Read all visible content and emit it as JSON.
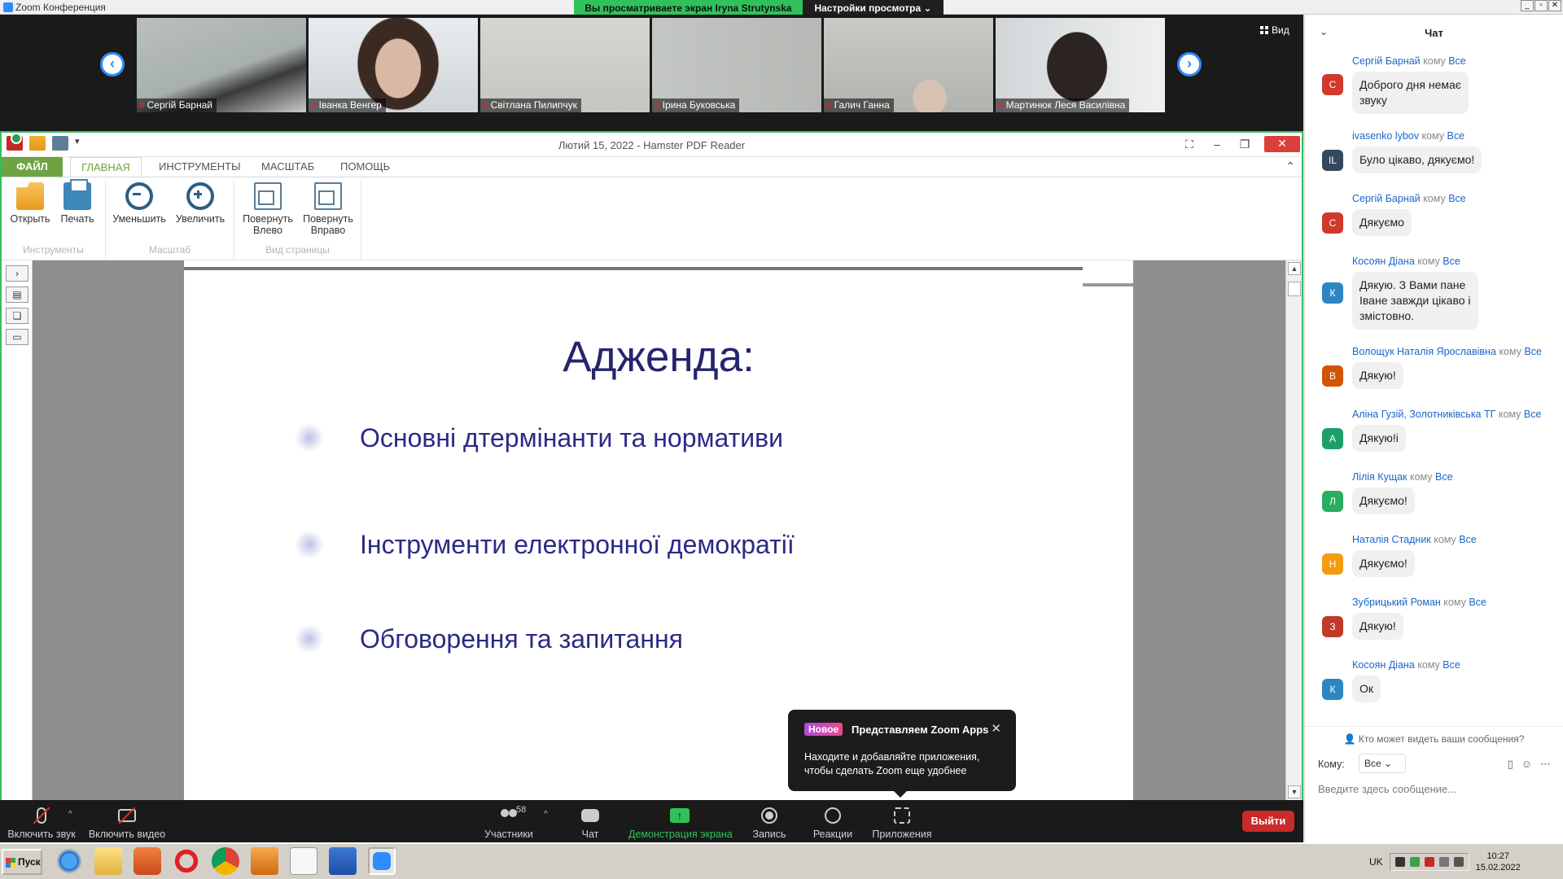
{
  "zoom": {
    "window_title": "Zoom Конференция",
    "share_banner": "Вы просматриваете экран Iryna Strutynska",
    "view_settings": "Настройки просмотра ⌄",
    "view_button": "Вид",
    "participants": [
      {
        "name": "Сергій Барнай"
      },
      {
        "name": "Іванка Венгер"
      },
      {
        "name": "Світлана Пилипчук"
      },
      {
        "name": "Ірина Буковська"
      },
      {
        "name": "Галич Ганна"
      },
      {
        "name": "Мартинюк Леся Василівна"
      }
    ]
  },
  "pdf": {
    "title": "Лютий 15, 2022 - Hamster PDF Reader",
    "tabs": {
      "file": "ФАЙЛ",
      "home": "ГЛАВНАЯ",
      "tools": "ИНСТРУМЕНТЫ",
      "scale": "МАСШТАБ",
      "help": "ПОМОЩЬ"
    },
    "ribbon": {
      "open": "Открыть",
      "print": "Печать",
      "group_tools": "Инструменты",
      "zoom_out": "Уменьшить",
      "zoom_in": "Увеличить",
      "group_scale": "Масштаб",
      "rotate_left_1": "Повернуть",
      "rotate_left_2": "Влево",
      "rotate_right_1": "Повернуть",
      "rotate_right_2": "Вправо",
      "group_view": "Вид страницы"
    },
    "slide": {
      "heading": "Адженда:",
      "items": [
        "Основні дтермінанти та нормативи",
        "Інструменти електронної демократії",
        "Обговорення та запитання"
      ]
    }
  },
  "popup": {
    "badge": "Новое",
    "title": "Представляем Zoom Apps",
    "body": "Находите и добавляйте приложения, чтобы сделать Zoom еще удобнее"
  },
  "toolbar": {
    "audio": "Включить звук",
    "video": "Включить видео",
    "participants": "Участники",
    "participants_count": "58",
    "chat": "Чат",
    "share": "Демонстрация экрана",
    "record": "Запись",
    "reactions": "Реакции",
    "apps": "Приложения",
    "leave": "Выйти"
  },
  "chat": {
    "title": "Чат",
    "to_word": "кому",
    "to_all": "Все",
    "messages": [
      {
        "sender": "Сергій Барнай",
        "initial": "С",
        "color": "#d0392b",
        "text_lines": [
          "Доброго дня немає",
          "звуку"
        ]
      },
      {
        "sender": "ivasenko lybov",
        "initial": "IL",
        "color": "#34495e",
        "text_lines": [
          "Було цікаво, дякуємо!"
        ]
      },
      {
        "sender": "Сергій Барнай",
        "initial": "С",
        "color": "#d0392b",
        "text_lines": [
          "Дякуємо"
        ]
      },
      {
        "sender": "Косоян Діана",
        "initial": "К",
        "color": "#2e86c1",
        "text_lines": [
          "Дякую. З Вами пане",
          "Іване завжди цікаво і",
          "змістовно."
        ]
      },
      {
        "sender": "Волощук Наталія Ярославівна",
        "initial": "В",
        "color": "#d35400",
        "text_lines": [
          "Дякую!"
        ]
      },
      {
        "sender": "Аліна Гузій, Золотниківська ТГ",
        "initial": "А",
        "color": "#1e9e6a",
        "text_lines": [
          "Дякую!і"
        ]
      },
      {
        "sender": "Лілія Кущак",
        "initial": "Л",
        "color": "#27ae60",
        "text_lines": [
          "Дякуємо!"
        ]
      },
      {
        "sender": "Наталія Стадник",
        "initial": "Н",
        "color": "#f39c12",
        "text_lines": [
          "Дякуємо!"
        ]
      },
      {
        "sender": "Зубрицький Роман",
        "initial": "З",
        "color": "#c0392b",
        "text_lines": [
          "Дякую!"
        ]
      },
      {
        "sender": "Косоян Діана",
        "initial": "К",
        "color": "#2e86c1",
        "text_lines": [
          "Ок"
        ]
      }
    ],
    "who_sees": "Кто может видеть ваши сообщения?",
    "to_label": "Кому:",
    "to_value": "Все ⌄",
    "input_placeholder": "Введите здесь сообщение..."
  },
  "taskbar": {
    "start": "Пуск",
    "lang": "UK",
    "time": "10:27",
    "date": "15.02.2022"
  },
  "colors": {
    "zoom_green": "#2fc25b",
    "zoom_blue": "#2d8cff",
    "leave_red": "#c92a2a",
    "slide_text": "#25246d",
    "ribbon_green": "#6ea342"
  }
}
